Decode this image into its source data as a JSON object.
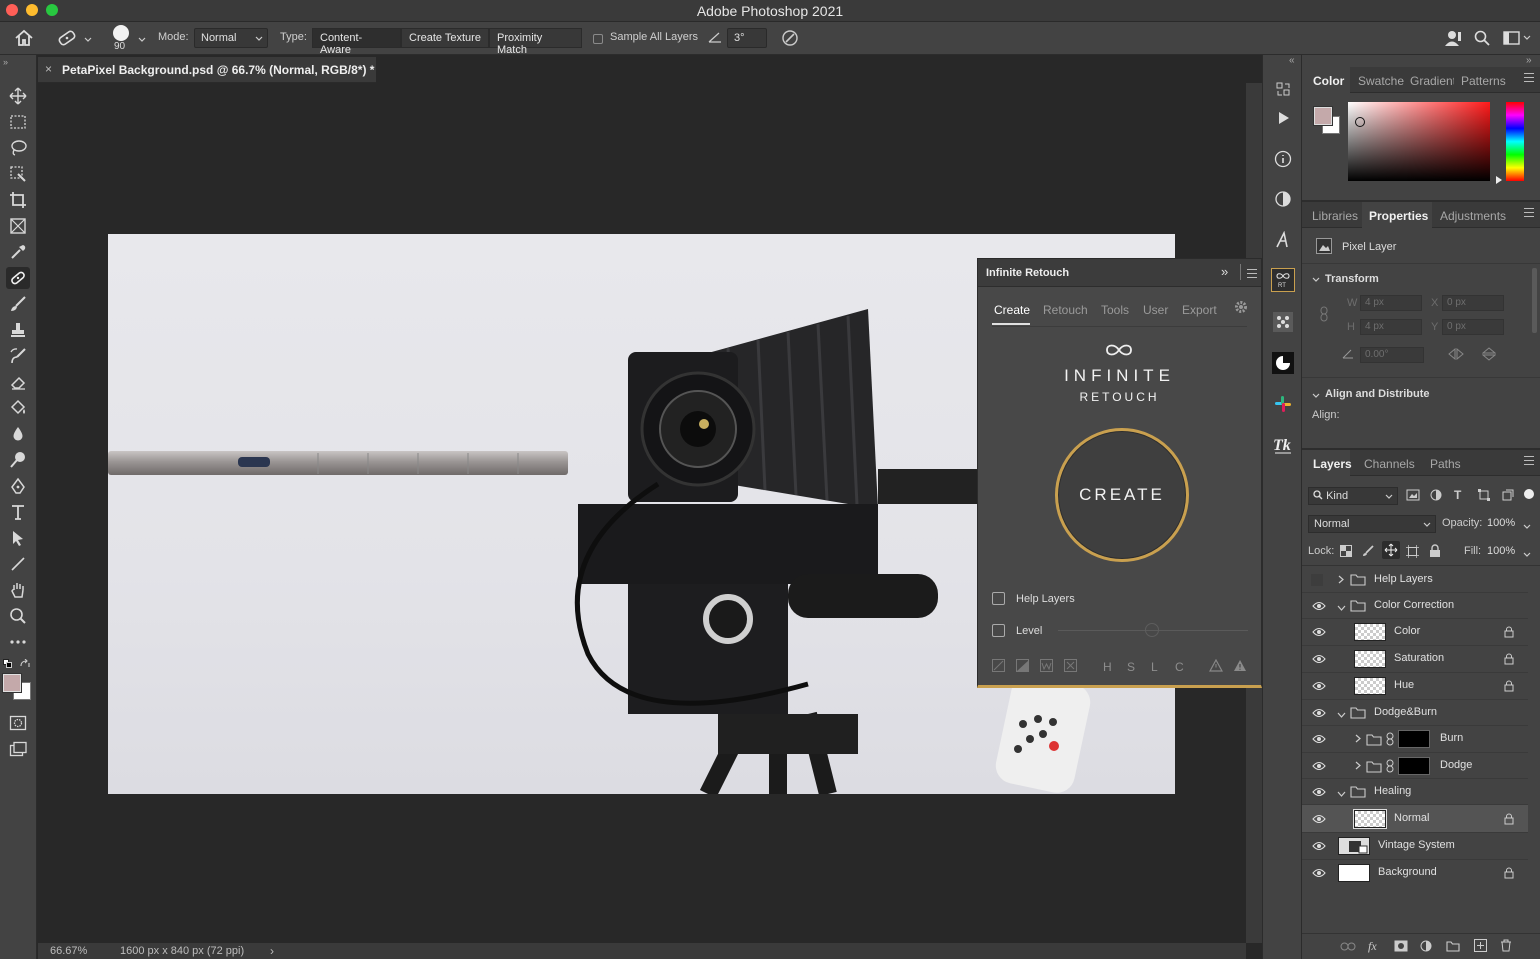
{
  "app": {
    "title": "Adobe Photoshop 2021"
  },
  "options_bar": {
    "brush_size": "90",
    "mode_label": "Mode:",
    "mode_value": "Normal",
    "type_label": "Type:",
    "type_buttons": [
      "Content-Aware",
      "Create Texture",
      "Proximity Match"
    ],
    "sample_all_layers": "Sample All Layers",
    "angle_value": "3°"
  },
  "document": {
    "tab_title": "PetaPixel Background.psd @ 66.7% (Normal, RGB/8*) *",
    "zoom": "66.67%",
    "dimensions": "1600 px x 840 px (72 ppi)"
  },
  "infinite_retouch": {
    "title": "Infinite Retouch",
    "tabs": [
      "Create",
      "Retouch",
      "Tools",
      "User",
      "Export"
    ],
    "active_tab": "Create",
    "logo_line1": "INFINITE",
    "logo_line2": "RETOUCH",
    "create_button": "CREATE",
    "help_layers": "Help Layers",
    "level": "Level",
    "hslc": [
      "H",
      "S",
      "L",
      "C"
    ],
    "accent": "#c9a04f"
  },
  "color_panel": {
    "tabs": [
      "Color",
      "Swatche",
      "Gradient",
      "Patterns"
    ],
    "foreground": "#c4a9aa",
    "background": "#ffffff"
  },
  "properties_panel": {
    "tabs": [
      "Libraries",
      "Properties",
      "Adjustments"
    ],
    "layer_type": "Pixel Layer",
    "transform": "Transform",
    "w_label": "W",
    "w_value": "4 px",
    "h_label": "H",
    "h_value": "4 px",
    "x_label": "X",
    "x_value": "0 px",
    "y_label": "Y",
    "y_value": "0 px",
    "angle_value": "0.00°",
    "align_distribute": "Align and Distribute",
    "align": "Align:"
  },
  "layers_panel": {
    "tabs": [
      "Layers",
      "Channels",
      "Paths"
    ],
    "filter_kind": "Kind",
    "blend_mode": "Normal",
    "opacity_label": "Opacity:",
    "opacity_value": "100%",
    "lock_label": "Lock:",
    "fill_label": "Fill:",
    "fill_value": "100%",
    "layers": [
      {
        "name": "Help Layers",
        "kind": "group",
        "indent": 0,
        "visible": false,
        "expanded": false
      },
      {
        "name": "Color Correction",
        "kind": "group",
        "indent": 0,
        "visible": true,
        "expanded": true
      },
      {
        "name": "Color",
        "kind": "pixel",
        "indent": 1,
        "visible": true,
        "locked": true
      },
      {
        "name": "Saturation",
        "kind": "pixel",
        "indent": 1,
        "visible": true,
        "locked": true
      },
      {
        "name": "Hue",
        "kind": "pixel",
        "indent": 1,
        "visible": true,
        "locked": true
      },
      {
        "name": "Dodge&Burn",
        "kind": "group",
        "indent": 0,
        "visible": true,
        "expanded": true
      },
      {
        "name": "Burn",
        "kind": "masked-group",
        "indent": 1,
        "visible": true
      },
      {
        "name": "Dodge",
        "kind": "masked-group",
        "indent": 1,
        "visible": true
      },
      {
        "name": "Healing",
        "kind": "group",
        "indent": 0,
        "visible": true,
        "expanded": true
      },
      {
        "name": "Normal",
        "kind": "pixel",
        "indent": 1,
        "visible": true,
        "locked": true,
        "selected": true
      },
      {
        "name": "Vintage System",
        "kind": "image",
        "indent": 0,
        "visible": true
      },
      {
        "name": "Background",
        "kind": "background",
        "indent": 0,
        "visible": true,
        "locked": true
      }
    ]
  }
}
